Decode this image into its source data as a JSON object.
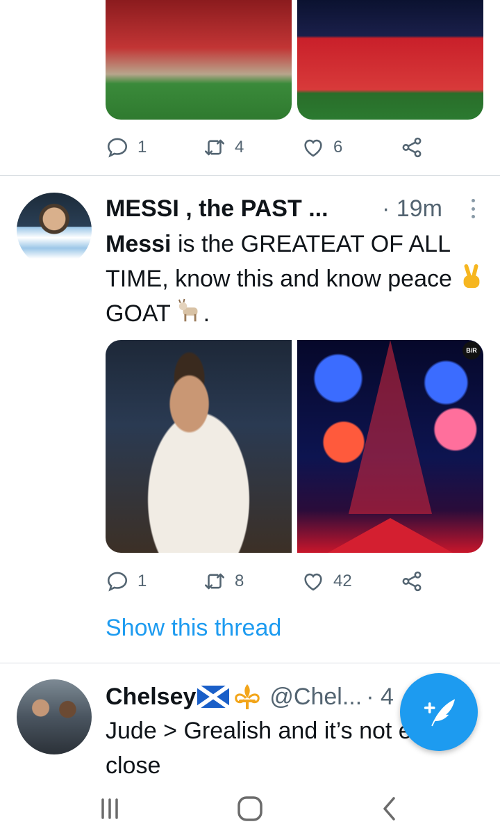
{
  "tweets": [
    {
      "actions": {
        "replies": "1",
        "retweets": "4",
        "likes": "6"
      }
    },
    {
      "author_name": "MESSI , the PAST ...",
      "time": "· 19m",
      "text_bold": "Messi",
      "text_rest": " is the GREATEAT OF ALL TIME, know this and know peace",
      "text_goat": "GOAT",
      "text_end": ".",
      "actions": {
        "replies": "1",
        "retweets": "8",
        "likes": "42"
      },
      "show_thread": "Show this thread",
      "media_badge": "B/R"
    },
    {
      "author_name": "Chelsey",
      "handle": "@Chel...",
      "time_partial": "· 4",
      "text": "Jude > Grealish and it’s not even close"
    }
  ],
  "icons": {
    "reply": "reply-icon",
    "retweet": "retweet-icon",
    "like": "heart-icon",
    "share": "share-icon",
    "more": "more-vertical-icon",
    "compose": "compose-tweet-icon",
    "nav_recents": "recents-icon",
    "nav_home": "home-icon",
    "nav_back": "back-icon"
  },
  "colors": {
    "accent": "#1d9bf0",
    "text_primary": "#0f1419",
    "text_secondary": "#536471",
    "divider": "#d9dee2"
  }
}
